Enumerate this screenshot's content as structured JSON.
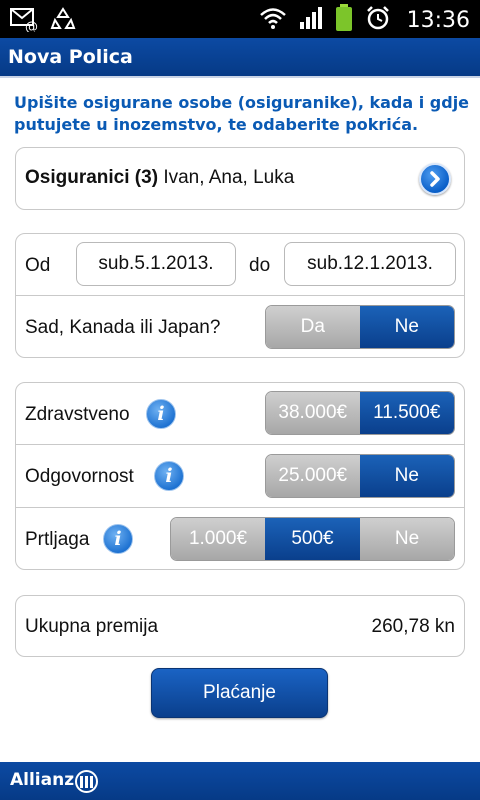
{
  "status_bar": {
    "time": "13:36"
  },
  "title_bar": {
    "title": "Nova Polica"
  },
  "intro_text": "Upišite osigurane osobe (osiguranike), kada i gdje putujete u inozemstvo, te odaberite pokrića.",
  "insured": {
    "label": "Osiguranici (3)",
    "names": "Ivan, Ana, Luka"
  },
  "travel": {
    "from_label": "Od",
    "from_date": "sub.5.1.2013.",
    "to_label": "do",
    "to_date": "sub.12.1.2013.",
    "usa_question": "Sad, Kanada ili Japan?",
    "usa_options": [
      "Da",
      "Ne"
    ],
    "usa_selected": "Ne"
  },
  "coverage": {
    "health": {
      "label": "Zdravstveno",
      "options": [
        "38.000€",
        "11.500€"
      ],
      "selected": "11.500€"
    },
    "liability": {
      "label": "Odgovornost",
      "options": [
        "25.000€",
        "Ne"
      ],
      "selected": "Ne"
    },
    "luggage": {
      "label": "Prtljaga",
      "options": [
        "1.000€",
        "500€",
        "Ne"
      ],
      "selected": "500€"
    }
  },
  "premium": {
    "label": "Ukupna premija",
    "value": "260,78 kn"
  },
  "pay_button": "Plaćanje",
  "footer": {
    "brand": "Allianz"
  },
  "colors": {
    "brand_blue": "#0a3f8c",
    "text_blue": "#0a5ab4",
    "segment_off": "#b5b5b5"
  }
}
